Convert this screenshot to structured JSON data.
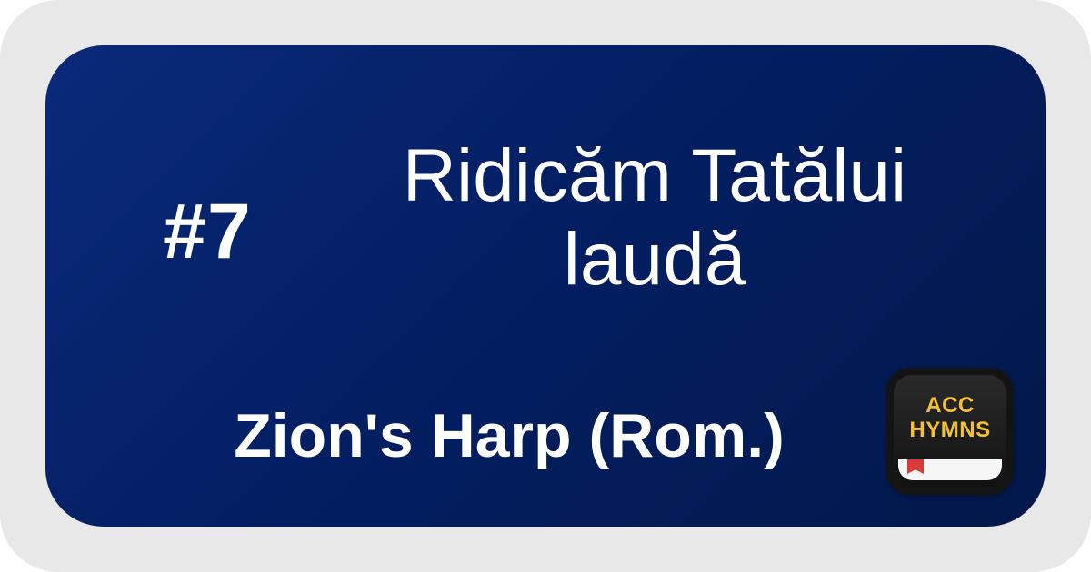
{
  "hymn": {
    "number": "#7",
    "title": "Ridicăm Tatălui laudă",
    "hymnal": "Zion's Harp (Rom.)"
  },
  "logo": {
    "line1": "ACC",
    "line2": "HYMNS"
  },
  "colors": {
    "frame": "#e8e8e8",
    "card": "#031f63",
    "text": "#ffffff",
    "logo_text": "#f4c230",
    "ribbon": "#d93a3a"
  }
}
